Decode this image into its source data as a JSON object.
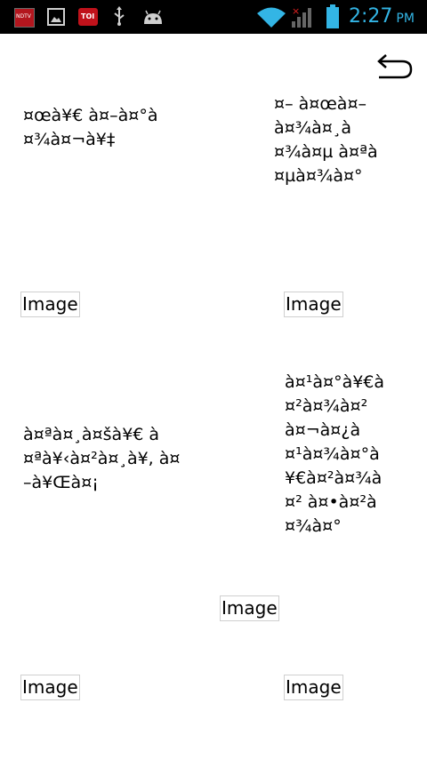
{
  "status_bar": {
    "ndtv_badge": "NDTV",
    "toi_badge": "TOI",
    "time": "2:27",
    "ampm": "PM",
    "colors": {
      "time": "#33b5e5",
      "wifi": "#33b5e5",
      "battery": "#33b5e5",
      "no_signal": "#e02020"
    }
  },
  "items": [
    {
      "text": "¤œà¥€ à¤–à¤°à\n¤¾à¤¬à¥‡"
    },
    {
      "text": "¤– à¤œà¤–\nà¤¾à¤¸à\n¤¾à¤µ à¤ªà\n¤µà¤¾à¤°"
    },
    {
      "text": "Image"
    },
    {
      "text": "Image"
    },
    {
      "text": "à¤ªà¤¸à¤šà¥€ à\n¤ªà¥‹à¤²à¤¸à¥, à¤\n–à¥Œà¤¡"
    },
    {
      "text": "à¤¹à¤°à¥€à\n¤²à¤¾à¤²\nà¤¬à¤¿à\n¤¹à¤¾à¤°à\n¥€à¤²à¤¾à\n¤² à¤•à¤²à\n¤¾à¤°"
    },
    {
      "text": "Image"
    },
    {
      "text": "Image"
    },
    {
      "text": "Image"
    }
  ]
}
